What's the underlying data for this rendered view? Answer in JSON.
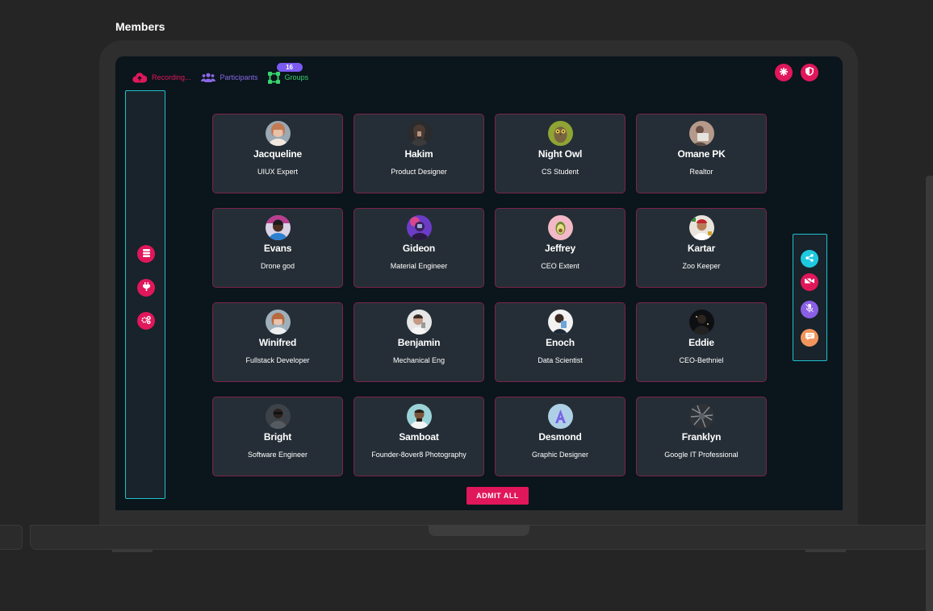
{
  "page": {
    "title": "Members"
  },
  "toolbar": {
    "recording_label": "Recording...",
    "participants_label": "Participants",
    "participants_count": "16",
    "groups_label": "Groups"
  },
  "admit_all_label": "ADMIT ALL",
  "colors": {
    "accent": "#e0175a",
    "panel_border": "#1fc1cc",
    "participants": "#8a68e6",
    "groups": "#39d46d",
    "card_bg": "#252e36",
    "card_border": "#7a2448"
  },
  "top_right_buttons": [
    {
      "icon": "settings-icon"
    },
    {
      "icon": "shield-icon"
    }
  ],
  "left_panel_buttons": [
    {
      "icon": "server-icon"
    },
    {
      "icon": "plug-icon"
    },
    {
      "icon": "cogs-icon"
    }
  ],
  "right_panel_buttons": [
    {
      "icon": "share-icon",
      "color": "#1ec9e0"
    },
    {
      "icon": "video-off-icon",
      "color": "#e0175a"
    },
    {
      "icon": "mic-off-icon",
      "color": "#8a5fe6"
    },
    {
      "icon": "chat-icon",
      "color": "#f0955e"
    }
  ],
  "members": [
    {
      "name": "Jacqueline",
      "role": "UIUX Expert"
    },
    {
      "name": "Hakim",
      "role": "Product Designer"
    },
    {
      "name": "Night Owl",
      "role": "CS Student"
    },
    {
      "name": "Omane PK",
      "role": "Realtor"
    },
    {
      "name": "Evans",
      "role": "Drone god"
    },
    {
      "name": "Gideon",
      "role": "Material Engineer"
    },
    {
      "name": "Jeffrey",
      "role": "CEO Extent"
    },
    {
      "name": "Kartar",
      "role": "Zoo Keeper"
    },
    {
      "name": "Winifred",
      "role": "Fullstack Developer"
    },
    {
      "name": "Benjamin",
      "role": "Mechanical Eng"
    },
    {
      "name": "Enoch",
      "role": "Data Scientist"
    },
    {
      "name": "Eddie",
      "role": "CEO-Bethniel"
    },
    {
      "name": "Bright",
      "role": "Software Engineer"
    },
    {
      "name": "Samboat",
      "role": "Founder-8over8 Photography"
    },
    {
      "name": "Desmond",
      "role": "Graphic Designer"
    },
    {
      "name": "Franklyn",
      "role": "Google IT Professional"
    }
  ]
}
